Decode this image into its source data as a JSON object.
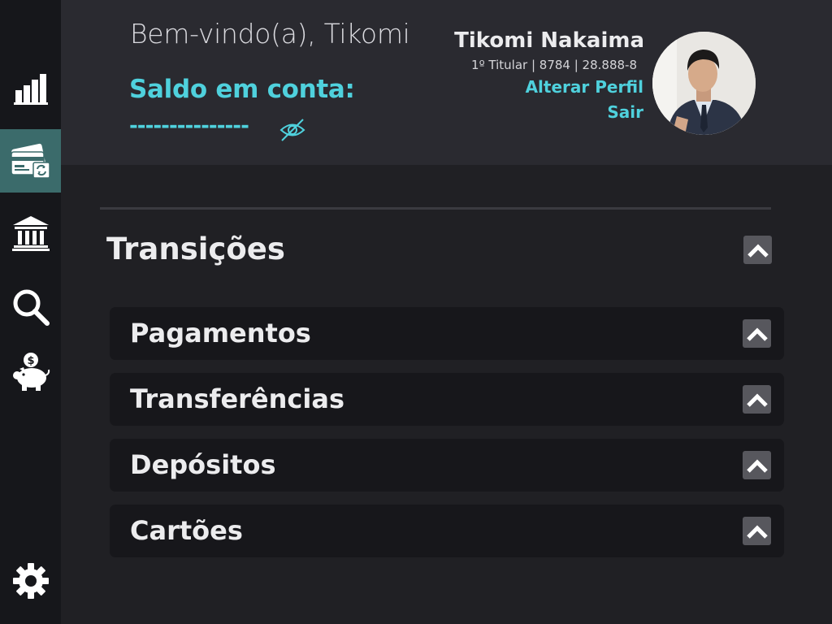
{
  "header": {
    "welcome": "Bem-vindo(a), Tikomi",
    "balance_label": "Saldo em conta:",
    "balance_hidden": "---------------",
    "toggle_icon": "eye-off-icon"
  },
  "profile": {
    "name": "Tikomi Nakaima",
    "account": "1º Titular | 8784 | 28.888-8",
    "edit_link": "Alterar Perfil",
    "logout_link": "Sair"
  },
  "sidebar": {
    "items": [
      {
        "icon": "bar-chart-icon"
      },
      {
        "icon": "card-icon",
        "active": true
      },
      {
        "icon": "bank-icon"
      },
      {
        "icon": "search-icon"
      },
      {
        "icon": "piggy-bank-icon"
      }
    ],
    "settings_icon": "gear-icon"
  },
  "main": {
    "section_title": "Transições",
    "accordions": [
      {
        "label": "Pagamentos"
      },
      {
        "label": "Transferências"
      },
      {
        "label": "Depósitos"
      },
      {
        "label": "Cartões"
      }
    ]
  },
  "colors": {
    "accent": "#4fd1dd",
    "active_nav": "#3b6b6b",
    "background": "#202024",
    "header": "#2a2a30",
    "sidebar": "#16171b"
  }
}
